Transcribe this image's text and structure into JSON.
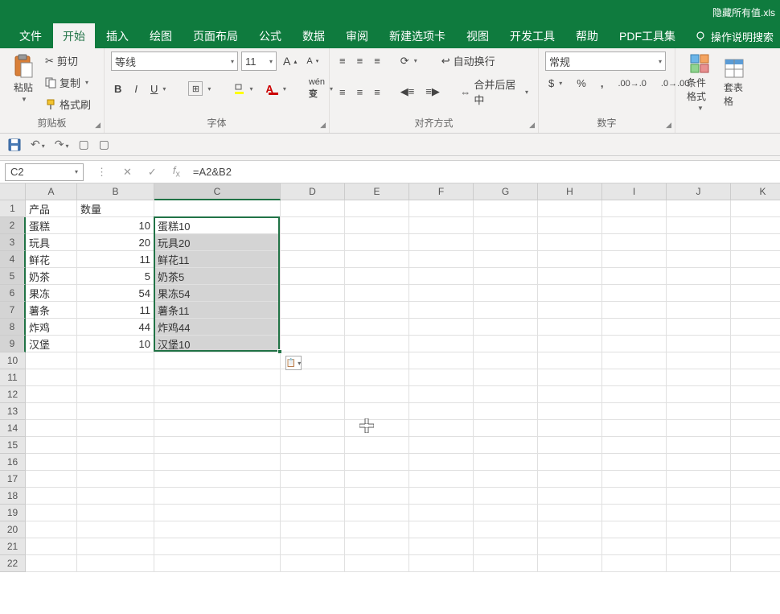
{
  "title": "隐藏所有值.xls",
  "tabs": [
    "文件",
    "开始",
    "插入",
    "绘图",
    "页面布局",
    "公式",
    "数据",
    "审阅",
    "新建选项卡",
    "视图",
    "开发工具",
    "帮助",
    "PDF工具集"
  ],
  "activeTab": 1,
  "searchHint": "操作说明搜索",
  "clipboard": {
    "paste": "粘贴",
    "cut": "剪切",
    "copy": "复制",
    "format": "格式刷",
    "label": "剪贴板"
  },
  "font": {
    "name": "等线",
    "size": "11",
    "label": "字体"
  },
  "align": {
    "wrap": "自动换行",
    "merge": "合并后居中",
    "label": "对齐方式"
  },
  "number": {
    "format": "常规",
    "label": "数字"
  },
  "styles": {
    "cond": "条件格式",
    "table": "套表格"
  },
  "nameBox": "C2",
  "formula": "=A2&B2",
  "colWidths": {
    "A": 64,
    "B": 96,
    "C": 157,
    "D": 80,
    "E": 80,
    "F": 80,
    "G": 80,
    "H": 80,
    "I": 80,
    "J": 80,
    "K": 80
  },
  "headers": {
    "A": "产品",
    "B": "数量"
  },
  "rows": [
    {
      "A": "蛋糕",
      "B": 10,
      "C": "蛋糕10"
    },
    {
      "A": "玩具",
      "B": 20,
      "C": "玩具20"
    },
    {
      "A": "鲜花",
      "B": 11,
      "C": "鲜花11"
    },
    {
      "A": "奶茶",
      "B": 5,
      "C": "奶茶5"
    },
    {
      "A": "果冻",
      "B": 54,
      "C": "果冻54"
    },
    {
      "A": "薯条",
      "B": 11,
      "C": "薯条11"
    },
    {
      "A": "炸鸡",
      "B": 44,
      "C": "炸鸡44"
    },
    {
      "A": "汉堡",
      "B": 10,
      "C": "汉堡10"
    }
  ],
  "selection": {
    "col": "C",
    "startRow": 2,
    "endRow": 9
  },
  "visibleRows": 22,
  "cols": [
    "A",
    "B",
    "C",
    "D",
    "E",
    "F",
    "G",
    "H",
    "I",
    "J",
    "K"
  ]
}
